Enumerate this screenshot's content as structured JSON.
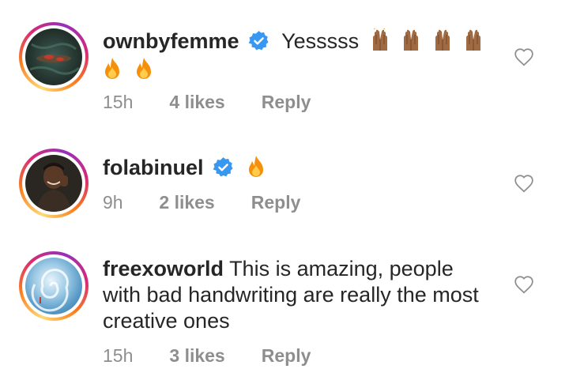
{
  "comments": [
    {
      "username": "ownbyfemme",
      "text": "Yesssss",
      "time": "15h",
      "likes": "4 likes",
      "reply": "Reply",
      "verified": true
    },
    {
      "username": "folabinuel",
      "text": "",
      "time": "9h",
      "likes": "2 likes",
      "reply": "Reply",
      "verified": true
    },
    {
      "username": "freexoworld",
      "text": "This is amazing, people",
      "text_line2": "with bad handwriting are really the most",
      "text_line3": "creative ones",
      "time": "15h",
      "likes": "3 likes",
      "reply": "Reply",
      "verified": false
    }
  ],
  "colors": {
    "text": "#262626",
    "meta": "#8e8e8e",
    "verified_blue": "#3897f0"
  },
  "icons": [
    "verified-badge-icon",
    "heart-outline-icon",
    "fire-emoji",
    "raised-hands-emoji"
  ]
}
